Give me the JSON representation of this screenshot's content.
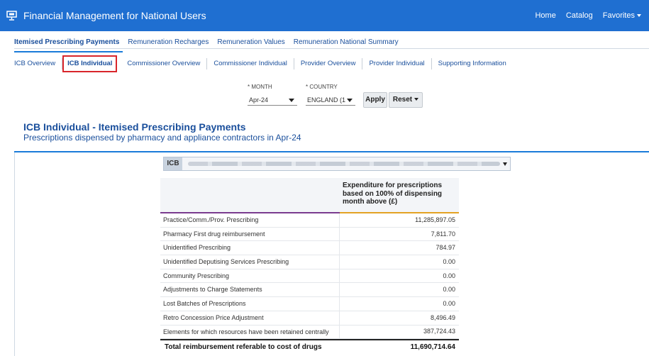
{
  "header": {
    "title": "Financial Management for National Users",
    "nav": [
      {
        "label": "Home"
      },
      {
        "label": "Catalog"
      },
      {
        "label": "Favorites"
      }
    ]
  },
  "primary_tabs": [
    {
      "label": "Itemised Prescribing Payments",
      "active": true
    },
    {
      "label": "Remuneration Recharges",
      "active": false
    },
    {
      "label": "Remuneration Values",
      "active": false
    },
    {
      "label": "Remuneration National Summary",
      "active": false
    }
  ],
  "secondary_tabs": [
    {
      "label": "ICB Overview",
      "active": false
    },
    {
      "label": "ICB Individual",
      "active": true
    },
    {
      "label": "Commissioner Overview",
      "active": false
    },
    {
      "label": "Commissioner Individual",
      "active": false
    },
    {
      "label": "Provider Overview",
      "active": false
    },
    {
      "label": "Provider Individual",
      "active": false
    },
    {
      "label": "Supporting Information",
      "active": false
    }
  ],
  "prompts": {
    "month": {
      "label": "* MONTH",
      "value": "Apr-24"
    },
    "country": {
      "label": "* COUNTRY",
      "value": "ENGLAND (1"
    },
    "apply_label": "Apply",
    "reset_label": "Reset"
  },
  "report": {
    "title": "ICB Individual - Itemised Prescribing Payments",
    "subtitle": "Prescriptions dispensed by pharmacy and appliance contractors in Apr-24",
    "icb_label": "ICB"
  },
  "table": {
    "column_header": "Expenditure for prescriptions based on 100% of dispensing month above (£)",
    "rows": [
      {
        "label": "Practice/Comm./Prov. Prescribing",
        "value": "11,285,897.05"
      },
      {
        "label": "Pharmacy First drug reimbursement",
        "value": "7,811.70"
      },
      {
        "label": "Unidentified Prescribing",
        "value": "784.97"
      },
      {
        "label": "Unidentified Deputising Services Prescribing",
        "value": "0.00"
      },
      {
        "label": "Community Prescribing",
        "value": "0.00"
      },
      {
        "label": "Adjustments to Charge Statements",
        "value": "0.00"
      },
      {
        "label": "Lost Batches of Prescriptions",
        "value": "0.00"
      },
      {
        "label": "Retro Concession Price Adjustment",
        "value": "8,496.49"
      },
      {
        "label": "Elements for which resources have been retained centrally",
        "value": "387,724.43"
      }
    ],
    "total": {
      "label": "Total reimbursement referable to cost of drugs",
      "value": "11,690,714.64"
    }
  },
  "colors": {
    "header_bg": "#1f6fd1",
    "link": "#1a4f9c",
    "active_highlight": "#d9262b",
    "col1_accent": "#7a3b8f",
    "col2_accent": "#e3a224"
  },
  "icons": {
    "app": "presentation-board-icon",
    "dropdown": "caret-down-icon"
  }
}
